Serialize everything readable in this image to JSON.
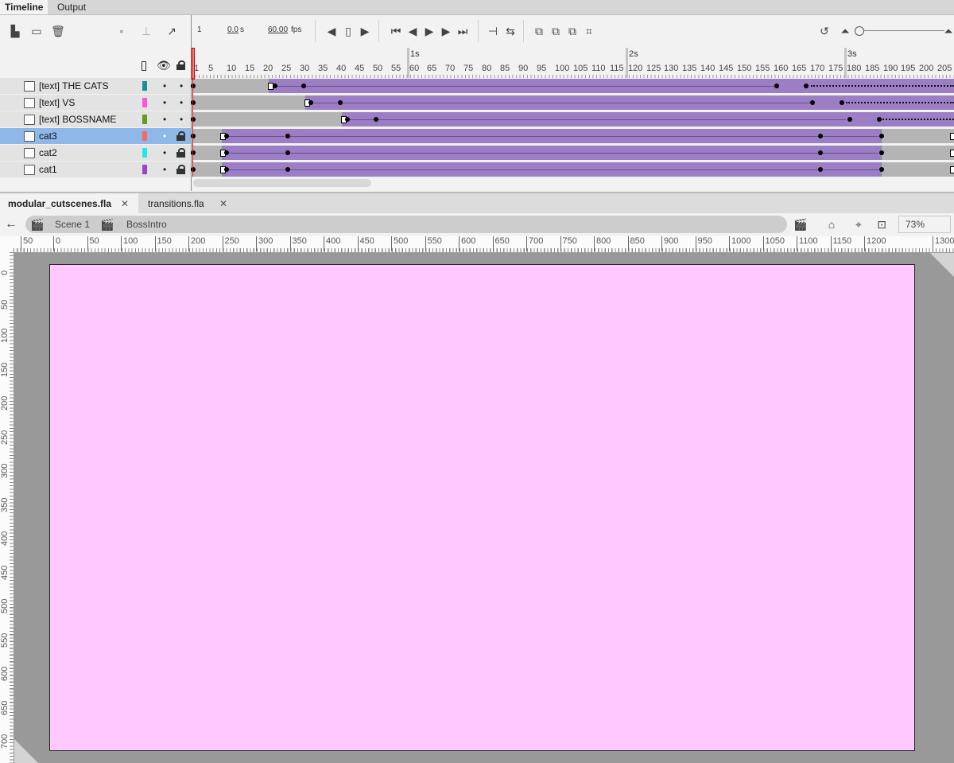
{
  "panel_tabs": [
    "Timeline",
    "Output"
  ],
  "toolbar": {
    "current_frame": "1",
    "elapsed": "0.0",
    "elapsed_unit": "s",
    "fps": "60.00",
    "fps_unit": "fps"
  },
  "timeline": {
    "seconds_markers": [
      "1s",
      "2s",
      "3s"
    ],
    "frame_numbers": [
      "1",
      "5",
      "10",
      "15",
      "20",
      "25",
      "30",
      "35",
      "40",
      "45",
      "50",
      "55",
      "60",
      "65",
      "70",
      "75",
      "80",
      "85",
      "90",
      "95",
      "100",
      "105",
      "110",
      "115",
      "120",
      "125",
      "130",
      "135",
      "140",
      "145",
      "150",
      "155",
      "160",
      "165",
      "170",
      "175",
      "180",
      "185",
      "190",
      "195",
      "200",
      "205"
    ],
    "layers": [
      {
        "name": "[text] THE CATS",
        "color": "#1a9090",
        "locked": false,
        "selected": false
      },
      {
        "name": "[text] VS",
        "color": "#ff55dd",
        "locked": false,
        "selected": false
      },
      {
        "name": "[text] BOSSNAME",
        "color": "#66991f",
        "locked": false,
        "selected": false
      },
      {
        "name": "cat3",
        "color": "#ff6666",
        "locked": true,
        "selected": true
      },
      {
        "name": "cat2",
        "color": "#22e8e8",
        "locked": true,
        "selected": false
      },
      {
        "name": "cat1",
        "color": "#9944cc",
        "locked": true,
        "selected": false
      }
    ]
  },
  "documents": {
    "tabs": [
      "modular_cutscenes.fla",
      "transitions.fla"
    ],
    "close_glyph": "✕"
  },
  "edit_bar": {
    "scene": "Scene 1",
    "symbol": "BossIntro",
    "zoom": "73%"
  },
  "ruler": {
    "top": [
      "50",
      "0",
      "50",
      "100",
      "150",
      "200",
      "250",
      "300",
      "350",
      "400",
      "450",
      "500",
      "550",
      "600",
      "650",
      "700",
      "750",
      "800",
      "850",
      "900",
      "950",
      "1000",
      "1050",
      "1100",
      "1150",
      "1200",
      "1300"
    ],
    "left": [
      "0",
      "50",
      "100",
      "150",
      "200",
      "250",
      "300",
      "350",
      "400",
      "450",
      "500",
      "550",
      "600",
      "650",
      "700"
    ]
  },
  "colors": {
    "stage": "#ffc9ff",
    "tween": "#9b7ec4",
    "selected_layer": "#8fb7e8"
  }
}
